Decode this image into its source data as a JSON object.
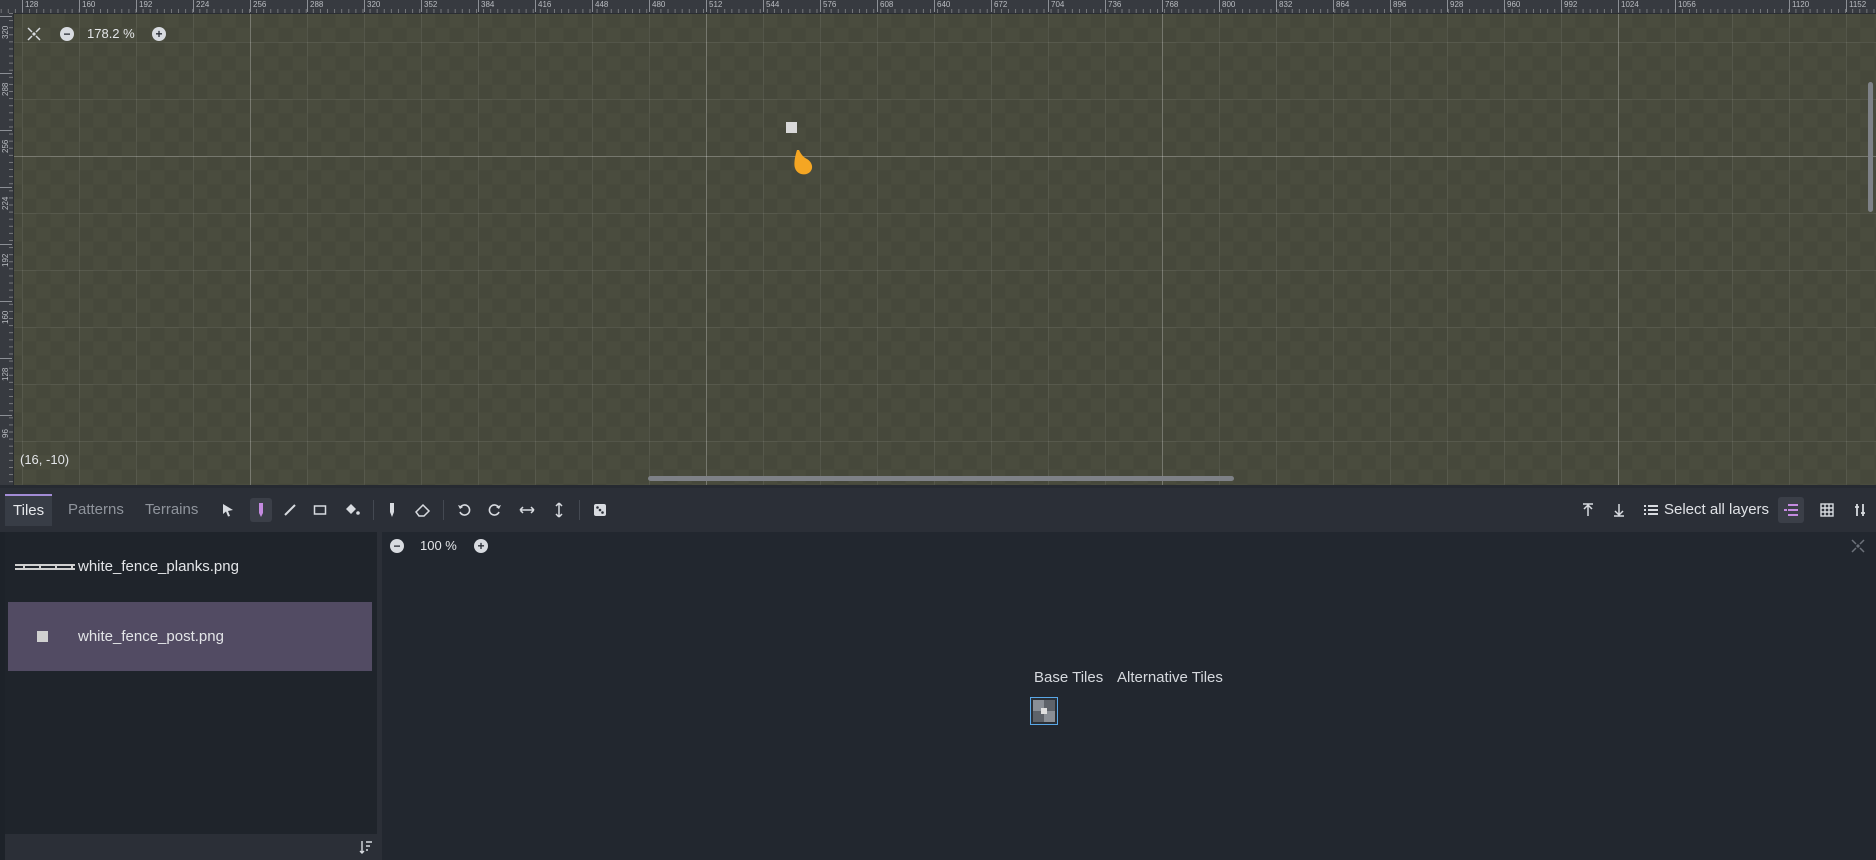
{
  "viewport": {
    "zoom_value": "178.2 %",
    "cursor_coords": "(16, -10)",
    "ruler_x": [
      "128",
      "160",
      "192",
      "224",
      "256",
      "288",
      "320",
      "352",
      "384",
      "416",
      "448",
      "480",
      "512",
      "544",
      "576",
      "608",
      "640",
      "672",
      "704",
      "736",
      "768",
      "800",
      "832",
      "864",
      "896",
      "928",
      "960",
      "992",
      "1024",
      "1056",
      "1120",
      "1152"
    ],
    "ruler_y": [
      "320",
      "288",
      "256",
      "224",
      "192",
      "160",
      "128",
      "96"
    ]
  },
  "toolbar": {
    "tabs": [
      "Tiles",
      "Patterns",
      "Terrains"
    ],
    "select_all_layers": "Select all layers",
    "accent_color": "#a38cd6"
  },
  "sources": {
    "items": [
      {
        "label": "white_fence_planks.png"
      },
      {
        "label": "white_fence_post.png"
      }
    ],
    "selected_index": 1
  },
  "atlas": {
    "zoom_value": "100 %",
    "tabs": [
      "Base Tiles",
      "Alternative Tiles"
    ]
  }
}
